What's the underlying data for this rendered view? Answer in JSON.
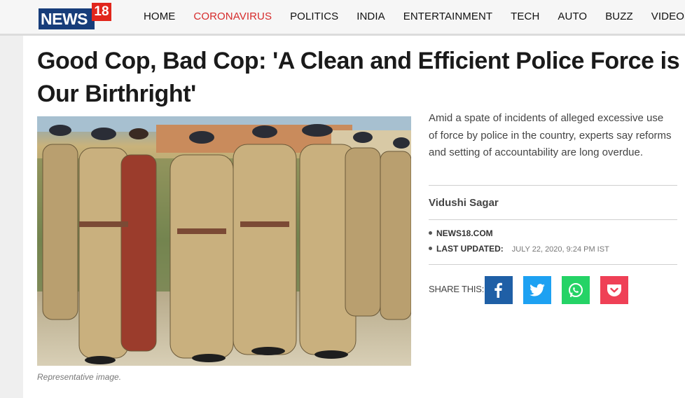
{
  "brand": {
    "logo_text": "NEWS",
    "logo_number": "18"
  },
  "nav": {
    "items": [
      {
        "label": "HOME"
      },
      {
        "label": "CORONAVIRUS",
        "active": true
      },
      {
        "label": "POLITICS"
      },
      {
        "label": "INDIA"
      },
      {
        "label": "ENTERTAINMENT"
      },
      {
        "label": "TECH"
      },
      {
        "label": "AUTO"
      },
      {
        "label": "BUZZ"
      },
      {
        "label": "VIDEOS"
      }
    ],
    "active_color": "#d62b2b"
  },
  "article": {
    "headline": "Good Cop, Bad Cop: 'A Clean and Efficient Police Force is Our Birthright'",
    "summary": "Amid a spate of incidents of alleged excessive use of force by police in the country, experts say reforms and setting of accountability are long overdue.",
    "author": "Vidushi Sagar",
    "source": "NEWS18.COM",
    "updated_label": "LAST UPDATED:",
    "updated_value": "JULY 22, 2020, 9:24 PM IST",
    "image_caption": "Representative image."
  },
  "share": {
    "label": "SHARE THIS:",
    "buttons": [
      {
        "icon": "facebook-icon",
        "color": "#1f5fa6"
      },
      {
        "icon": "twitter-icon",
        "color": "#1da1f2"
      },
      {
        "icon": "whatsapp-icon",
        "color": "#25d366"
      },
      {
        "icon": "pocket-icon",
        "color": "#ef4056"
      }
    ]
  }
}
